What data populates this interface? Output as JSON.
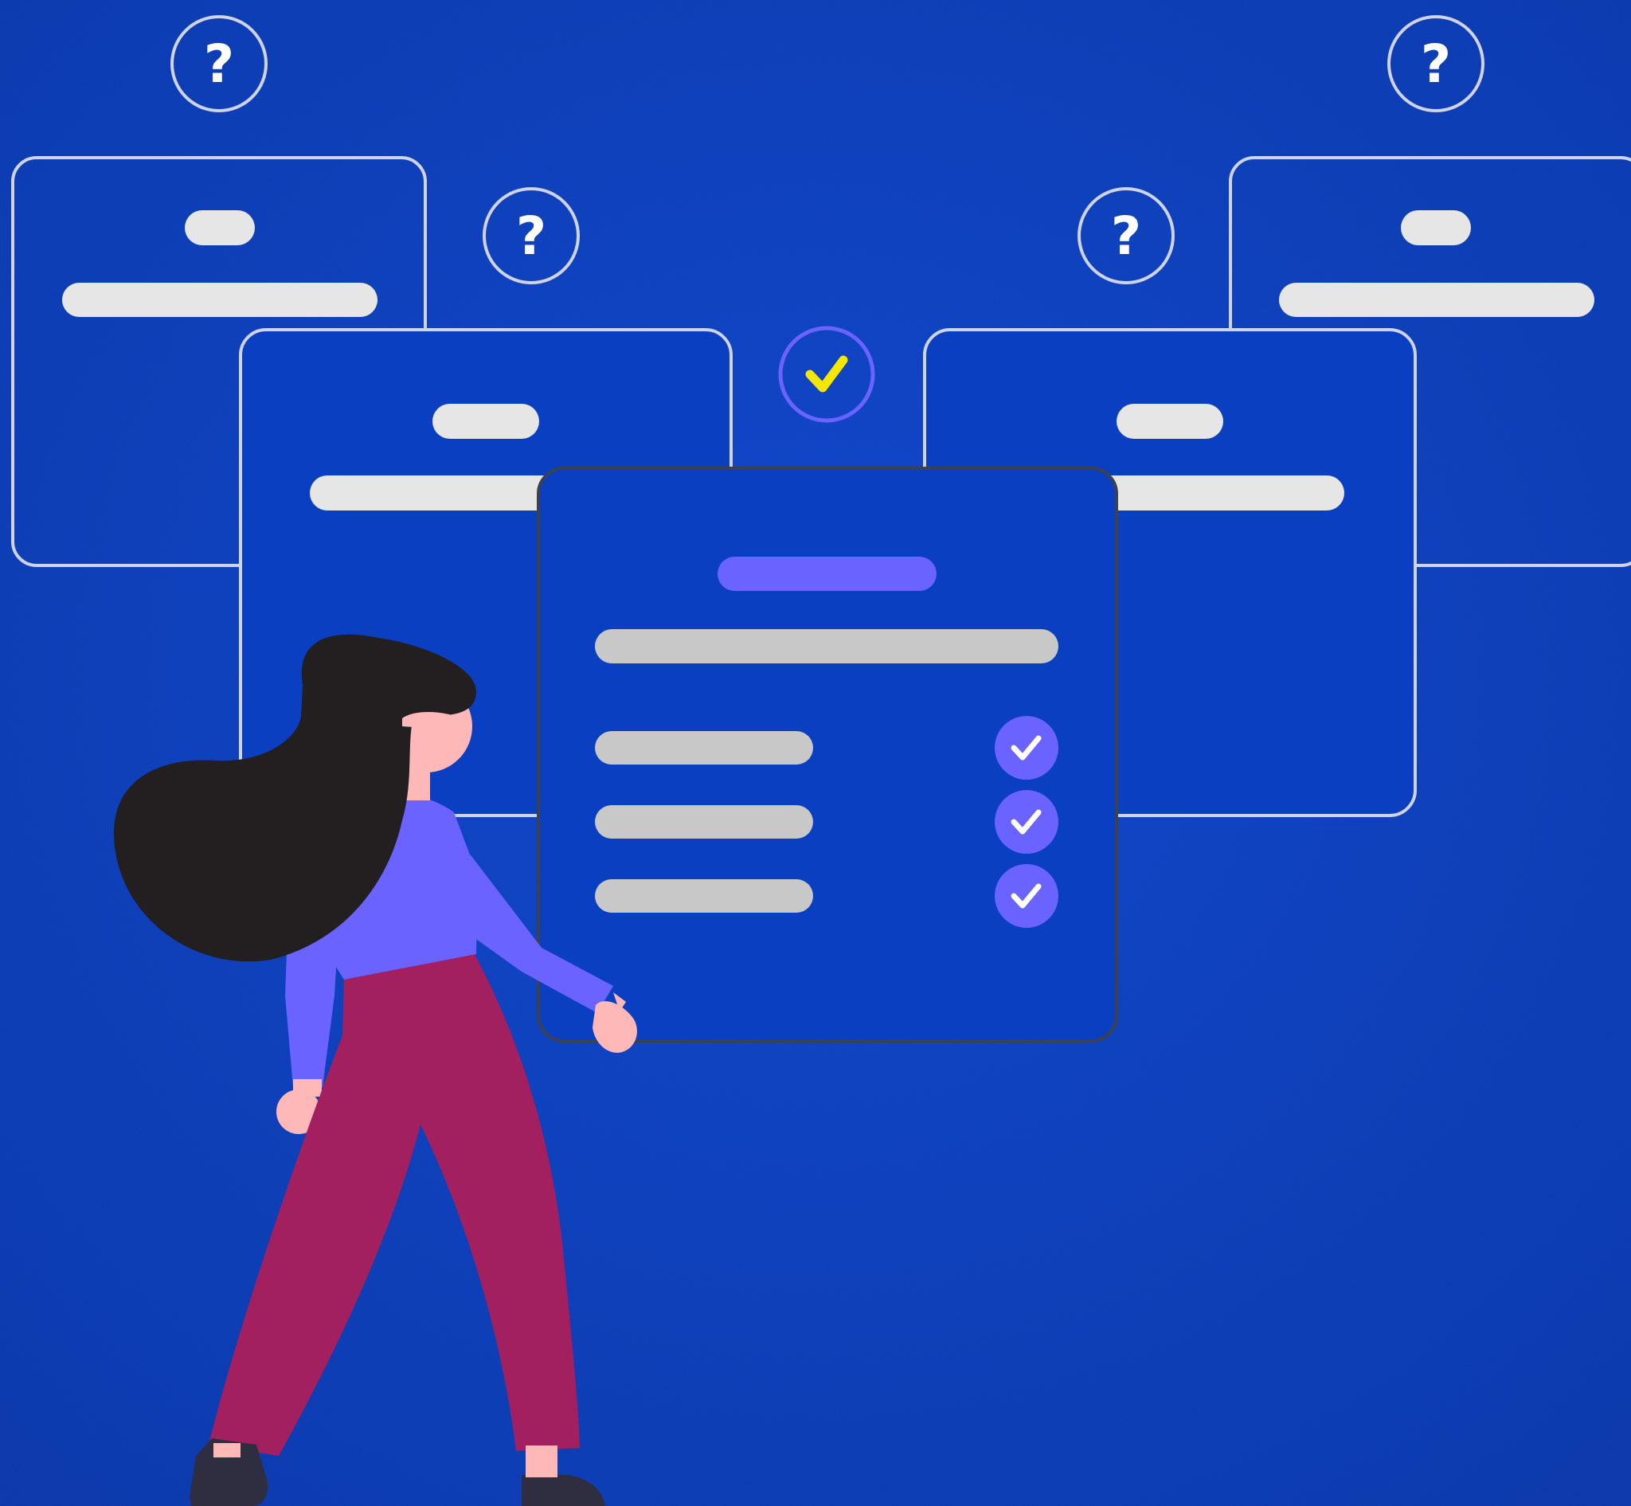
{
  "scene": {
    "description_none": "",
    "colors": {
      "background": "#0b3fc2",
      "background_dark": "#0633a6",
      "card_outline": "#cfd3e6",
      "card_outline_dark": "#3c4150",
      "placeholder_bar": "#e6e6e6",
      "placeholder_bar_gray": "#c8c8c8",
      "accent_purple": "#6b63ff",
      "check_yellow": "#f5e800",
      "hair": "#231f20",
      "skin": "#ffb8b8",
      "shirt": "#6b63ff",
      "pants": "#a21f60",
      "shoes": "#2f2e41"
    },
    "icons": {
      "question": "question-mark-icon",
      "check": "checkmark-icon"
    },
    "glyphs": {
      "question": "?"
    },
    "background_cards": [
      {
        "id": "card-top-left",
        "has_question_badge": true
      },
      {
        "id": "card-mid-left",
        "has_question_badge": true
      },
      {
        "id": "card-mid-right",
        "has_question_badge": true
      },
      {
        "id": "card-top-right",
        "has_question_badge": true
      }
    ],
    "center_card": {
      "checklist_rows": 3,
      "checked_rows": 3
    },
    "top_check_badge": {
      "state": "checked"
    }
  }
}
